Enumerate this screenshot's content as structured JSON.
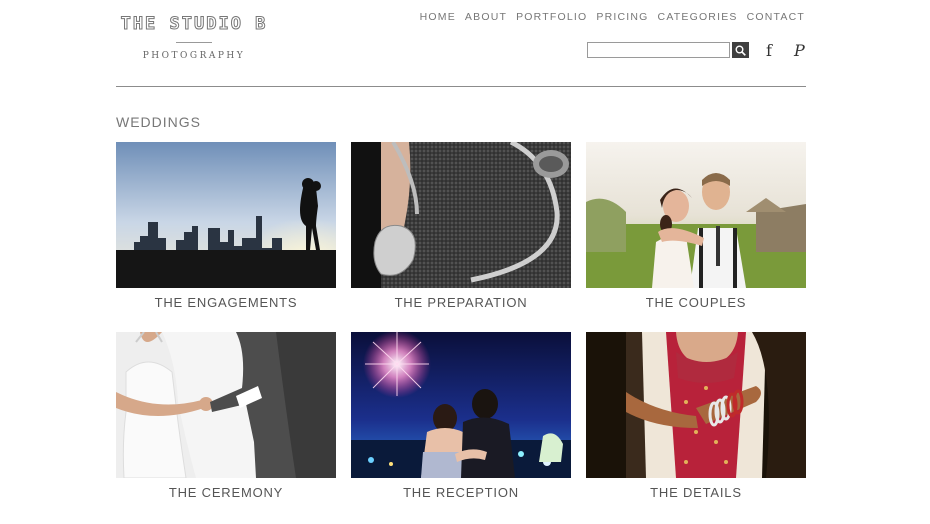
{
  "logo": {
    "title": "THE STUDIO B",
    "subtitle": "PHOTOGRAPHY"
  },
  "nav": [
    "HOME",
    "ABOUT",
    "PORTFOLIO",
    "PRICING",
    "CATEGORIES",
    "CONTACT"
  ],
  "search": {
    "value": "",
    "placeholder": "",
    "button_icon": "search-icon"
  },
  "social": {
    "facebook": "f",
    "pinterest": "P"
  },
  "section_title": "WEDDINGS",
  "tiles": [
    {
      "caption": "THE ENGAGEMENTS"
    },
    {
      "caption": "THE PREPARATION"
    },
    {
      "caption": "THE COUPLES"
    },
    {
      "caption": "THE CEREMONY"
    },
    {
      "caption": "THE RECEPTION"
    },
    {
      "caption": "THE DETAILS"
    }
  ]
}
